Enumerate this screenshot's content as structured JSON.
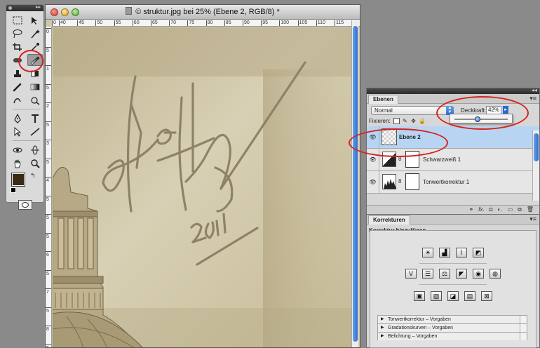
{
  "document": {
    "title": "© struktur.jpg bei 25% (Ebene 2, RGB/8) *",
    "ruler_top": [
      "0",
      "40",
      "45",
      "50",
      "55",
      "60",
      "65",
      "70",
      "75",
      "80",
      "85",
      "90",
      "95",
      "100",
      "105",
      "110",
      "115"
    ],
    "ruler_left": [
      "0",
      "5",
      "1",
      "5",
      "2",
      "5",
      "3",
      "5",
      "4",
      "5",
      "5",
      "5",
      "6",
      "5",
      "7",
      "5",
      "8",
      "5"
    ]
  },
  "layers_panel": {
    "tab": "Ebenen",
    "blend_mode": "Normal",
    "opacity_label": "Deckkraft:",
    "opacity_value": "42%",
    "opacity_level": 0.42,
    "lock_label": "Fixieren:",
    "layers": [
      {
        "name": "Ebene 2",
        "selected": true
      },
      {
        "name": "Schwarzweiß 1",
        "selected": false
      },
      {
        "name": "Tonwertkorrektur 1",
        "selected": false
      }
    ],
    "footer_icons": [
      "link-icon",
      "fx-icon",
      "mask-icon",
      "adjustment-icon",
      "folder-icon",
      "new-layer-icon",
      "trash-icon"
    ]
  },
  "adjustments_panel": {
    "tab": "Korrekturen",
    "heading": "Korrektur hinzufügen",
    "presets": [
      "Tonwertkorrektur – Vorgaben",
      "Gradationskurven – Vorgaben",
      "Belichtung – Vorgaben"
    ]
  },
  "colors": {
    "foreground": "#3a2a16",
    "background": "#ffffff",
    "annotation": "#d6221f",
    "selection": "#b8d4f3"
  }
}
